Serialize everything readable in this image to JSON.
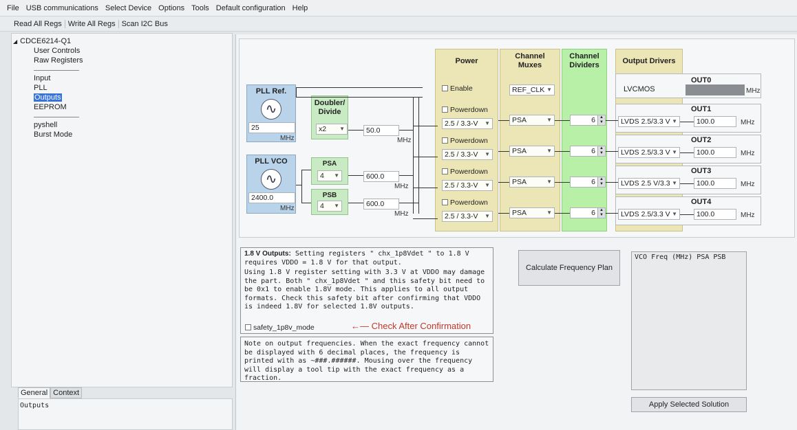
{
  "menu": [
    "File",
    "USB communications",
    "Select Device",
    "Options",
    "Tools",
    "Default configuration",
    "Help"
  ],
  "toolbar": [
    "Read All Regs",
    "Write All Regs",
    "Scan I2C Bus"
  ],
  "tree": {
    "root": "CDCE6214-Q1",
    "group1": [
      "User Controls",
      "Raw Registers"
    ],
    "group2": [
      "Input",
      "PLL",
      "Outputs",
      "EEPROM"
    ],
    "group3": [
      "pyshell",
      "Burst Mode"
    ],
    "collapse_icon": "triangle-down-icon"
  },
  "left_tabs": [
    "General",
    "Context"
  ],
  "context_text": "Outputs",
  "columns": {
    "power": "Power",
    "channel_muxes": "Channel\nMuxes",
    "channel_dividers": "Channel\nDividers",
    "output_drivers": "Output Drivers"
  },
  "pll_ref": {
    "label": "PLL Ref.",
    "value": "25",
    "unit": "MHz"
  },
  "doubler": {
    "label": "Doubler/\nDivide",
    "value": "x2",
    "freq": "50.0",
    "unit": "MHz"
  },
  "pll_vco": {
    "label": "PLL VCO",
    "value": "2400.0",
    "unit": "MHz"
  },
  "psa": {
    "label": "PSA",
    "value": "4",
    "freq": "600.0",
    "unit": "MHz"
  },
  "psb": {
    "label": "PSB",
    "value": "4",
    "freq": "600.0",
    "unit": "MHz"
  },
  "out0": {
    "label": "OUT0",
    "enable": "Enable",
    "mux": "REF_CLK",
    "driver": "LVCMOS",
    "freq": "",
    "unit": "MHz"
  },
  "outputs": [
    {
      "label": "OUT1",
      "powerdown": "Powerdown",
      "voltage": "2.5 / 3.3-V",
      "mux": "PSA",
      "divider": "6",
      "driver": "LVDS 2.5/3.3 V",
      "freq": "100.0",
      "unit": "MHz"
    },
    {
      "label": "OUT2",
      "powerdown": "Powerdown",
      "voltage": "2.5 / 3.3-V",
      "mux": "PSA",
      "divider": "6",
      "driver": "LVDS 2.5/3.3 V",
      "freq": "100.0",
      "unit": "MHz"
    },
    {
      "label": "OUT3",
      "powerdown": "Powerdown",
      "voltage": "2.5 / 3.3-V",
      "mux": "PSA",
      "divider": "6",
      "driver": "LVDS 2.5 V/3.3",
      "freq": "100.0",
      "unit": "MHz"
    },
    {
      "label": "OUT4",
      "powerdown": "Powerdown",
      "voltage": "2.5 / 3.3-V",
      "mux": "PSA",
      "divider": "6",
      "driver": "LVDS 2.5/3.3 V",
      "freq": "100.0",
      "unit": "MHz"
    }
  ],
  "info": {
    "title": "1.8 V Outputs:",
    "line1": "Setting registers \" chx_1p8Vdet \" to 1.8 V requires VDDO = 1.8 V for that output.",
    "body": "Using 1.8 V register setting with 3.3 V at VDDO may damage the part. Both \" chx_1p8Vdet \" and this safety bit need to be 0x1 to enable 1.8V mode. This applies to all output formats. Check this safety bit after confirming that VDDO is indeed 1.8V for selected 1.8V outputs.",
    "checkbox": "safety_1p8v_mode",
    "warning": "←— Check After Confirmation"
  },
  "note": "Note on output frequencies. When the exact frequency cannot be displayed with 6 decimal places, the frequency is printed with as ~###.######. Mousing over the frequency will display a tool tip with the exact frequency as a fraction.",
  "buttons": {
    "calculate": "Calculate Frequency Plan",
    "apply": "Apply Selected Solution"
  },
  "solutions_header": "VCO Freq (MHz) PSA PSB",
  "colors": {
    "blue_block": "#b8d3ea",
    "green_block": "#c9ebc4",
    "column_yellow": "#ece6b6",
    "divider_green": "#b9f0a8",
    "selection": "#3874d8",
    "warning_red": "#c0392b"
  }
}
